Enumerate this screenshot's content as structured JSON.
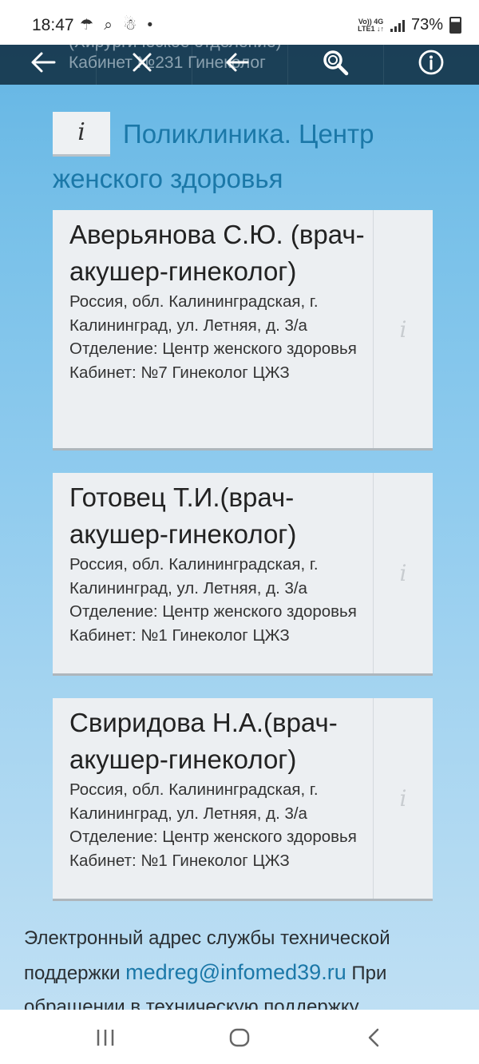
{
  "status_bar": {
    "time": "18:47",
    "left_icons": "☂ ⌕ ☃ •",
    "network_top": "Vo)) 4G",
    "network_bottom": "LTE1 ↓↑",
    "battery": "73%"
  },
  "toolbar": {
    "ghost_line1": "(Хирургическое отделение)",
    "ghost_line2": "Кабинет №231 Гинеколог",
    "icons": [
      "back-arrow-icon",
      "close-icon",
      "undo-arrow-icon",
      "search-icon",
      "info-icon"
    ]
  },
  "section": {
    "info_glyph": "i",
    "title": "Поликлиника. Центр женского здоровья"
  },
  "doctors": [
    {
      "name": "Аверьянова С.Ю. (врач-акушер-гинеколог)",
      "address": "Россия, обл. Калининградская, г. Калининград, ул. Летняя, д. 3/а",
      "department": "Отделение: Центр женского здоровья",
      "cabinet": "Кабинет: №7 Гинеколог ЦЖЗ",
      "info_glyph": "i"
    },
    {
      "name": "Готовец Т.И.(врач-акушер-гинеколог)",
      "address": "Россия, обл. Калининградская, г. Калининград, ул. Летняя, д. 3/а",
      "department": "Отделение: Центр женского здоровья",
      "cabinet": "Кабинет: №1 Гинеколог ЦЖЗ",
      "info_glyph": "i"
    },
    {
      "name": "Свиридова Н.А.(врач-акушер-гинеколог)",
      "address": "Россия, обл. Калининградская, г. Калининград, ул. Летняя, д. 3/а",
      "department": "Отделение: Центр женского здоровья",
      "cabinet": "Кабинет: №1 Гинеколог ЦЖЗ",
      "info_glyph": "i"
    }
  ],
  "footer": {
    "text_before": "Электронный адрес службы технической поддержки ",
    "email": "medreg@infomed39.ru",
    "text_after": " При обращении в техническую поддержку"
  },
  "nav_bar": {
    "icons": [
      "recent-apps-icon",
      "home-icon",
      "back-icon"
    ]
  }
}
